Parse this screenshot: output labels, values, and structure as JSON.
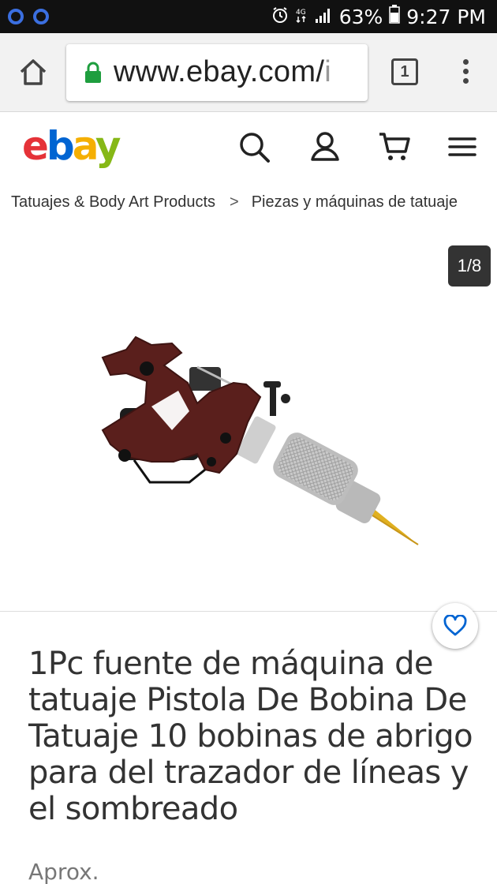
{
  "status_bar": {
    "battery": "63%",
    "time": "9:27 PM",
    "icons": [
      "notification-dot-icon",
      "notification-dot-icon",
      "alarm-icon",
      "4g-icon",
      "signal-icon",
      "battery-icon"
    ],
    "background": "#111111"
  },
  "browser": {
    "url_host": "www.ebay.com/",
    "url_path": "i",
    "tab_count": "1",
    "icons": [
      "home-icon",
      "lock-icon",
      "tabs-icon",
      "overflow-menu-icon"
    ],
    "lock_color": "#1e9e3e"
  },
  "header": {
    "logo": {
      "e": "e",
      "b": "b",
      "a": "a",
      "y": "y"
    },
    "logo_colors": {
      "e": "#e53238",
      "b": "#0064d2",
      "a": "#f5af02",
      "y": "#86b817"
    },
    "icons": [
      "search-icon",
      "account-icon",
      "cart-icon",
      "hamburger-menu-icon"
    ]
  },
  "breadcrumb": {
    "items": [
      "Tatuajes & Body Art Products",
      "Piezas y máquinas de tatuaje"
    ],
    "separator": ">"
  },
  "gallery": {
    "counter": "1/8"
  },
  "listing": {
    "title": "1Pc fuente de máquina de tatuaje Pistola De Bobina De Tatuaje 10 bobinas de abrigo para del trazador de líneas y el sombreado",
    "price_prefix": "Aprox.",
    "favorite_icon": "heart-icon",
    "accent": "#0064d2"
  }
}
